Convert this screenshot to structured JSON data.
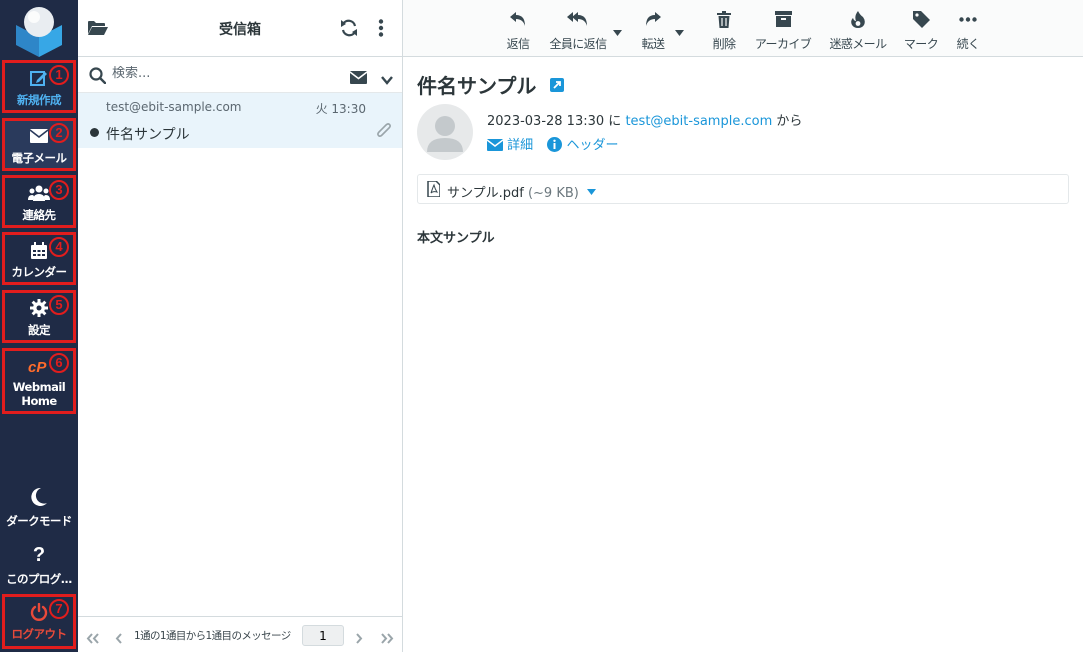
{
  "sidebar": {
    "items": [
      {
        "label": "新規作成",
        "number": "1"
      },
      {
        "label": "電子メール",
        "number": "2"
      },
      {
        "label": "連絡先",
        "number": "3"
      },
      {
        "label": "カレンダー",
        "number": "4"
      },
      {
        "label": "設定",
        "number": "5"
      },
      {
        "label": "Webmail",
        "label2": "Home",
        "number": "6"
      },
      {
        "label": "ダークモード"
      },
      {
        "label": "このプログ..."
      },
      {
        "label": "ログアウト",
        "number": "7"
      }
    ]
  },
  "list": {
    "folder_title": "受信箱",
    "search_placeholder": "検索...",
    "messages": [
      {
        "from": "test@ebit-sample.com",
        "date": "火 13:30",
        "subject": "件名サンプル"
      }
    ],
    "pager_text": "1通の1通目から1通目のメッセージ",
    "page": "1"
  },
  "toolbar": {
    "reply": "返信",
    "reply_all": "全員に返信",
    "forward": "転送",
    "delete": "削除",
    "archive": "アーカイブ",
    "junk": "迷惑メール",
    "mark": "マーク",
    "more": "続く"
  },
  "message": {
    "subject": "件名サンプル",
    "date": "2023-03-28 13:30",
    "date_suffix": "に",
    "sender": "test@ebit-sample.com",
    "from_suffix": "から",
    "details": "詳細",
    "headers": "ヘッダー",
    "attachment_name": "サンプル.pdf",
    "attachment_size": "(~9 KB)",
    "body": "本文サンプル"
  },
  "colors": {
    "sidebar_bg": "#1f2b46",
    "accent": "#1a96d9",
    "annotation_red": "#e11d1d"
  }
}
